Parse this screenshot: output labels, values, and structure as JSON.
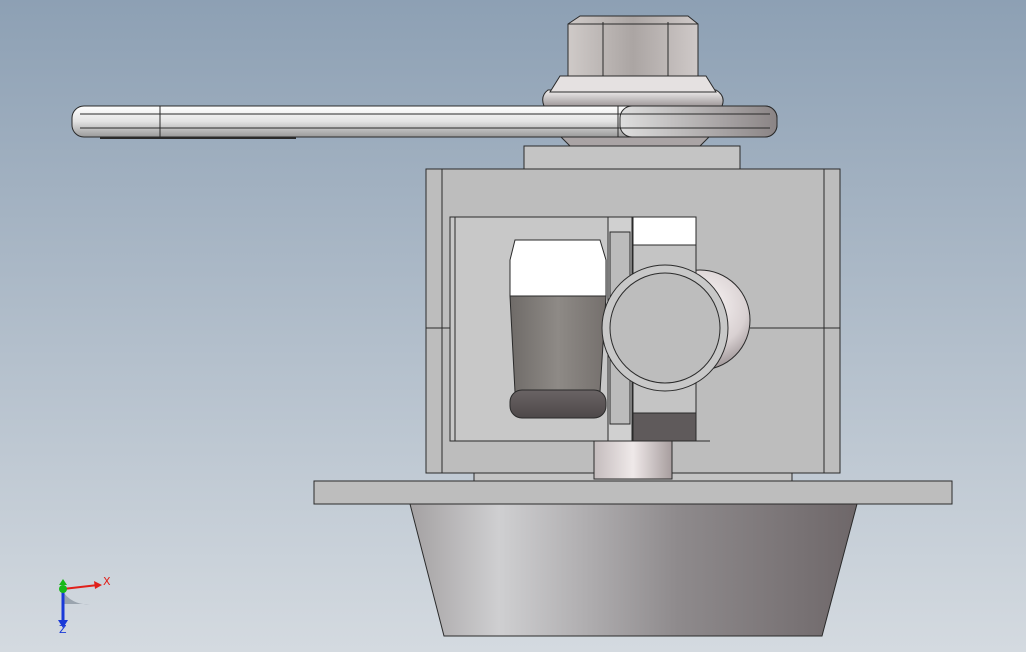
{
  "app": {
    "view": "cad-3d-viewport",
    "model": "ball-valve-assembly"
  },
  "colors": {
    "background_top": "#8da0b4",
    "background_bottom": "#d4dae0",
    "metal_light": "#e8e8e8",
    "metal_mid": "#bdbdbd",
    "metal_dark": "#777373",
    "edge": "#2a2a2a",
    "axis_x": "#e0201a",
    "axis_y": "#18b818",
    "axis_z": "#1a3ad8"
  },
  "triad": {
    "x_label": "X",
    "z_label": "Z"
  },
  "icons": {
    "triad": "coordinate-triad-icon"
  }
}
